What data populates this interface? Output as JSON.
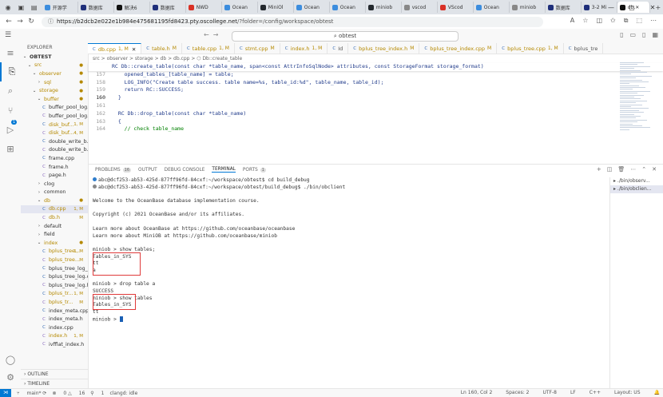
{
  "browser": {
    "tabs": [
      {
        "label": "开源学",
        "color": "#3c8dde"
      },
      {
        "label": "数据库",
        "color": "#1f2f7a"
      },
      {
        "label": "解决6",
        "color": "#111111"
      },
      {
        "label": "数据库",
        "color": "#1f2f7a"
      },
      {
        "label": "NWD",
        "color": "#d93025"
      },
      {
        "label": "Ocean",
        "color": "#3c8dde"
      },
      {
        "label": "MiniOl",
        "color": "#24292e"
      },
      {
        "label": "Ocean",
        "color": "#3c8dde"
      },
      {
        "label": "Ocean",
        "color": "#3c8dde"
      },
      {
        "label": "miniob",
        "color": "#24292e"
      },
      {
        "label": "vscod",
        "color": "#888888"
      },
      {
        "label": "VScod",
        "color": "#d93025"
      },
      {
        "label": "Ocean",
        "color": "#3c8dde"
      },
      {
        "label": "miniob",
        "color": "#888888"
      },
      {
        "label": "数据库",
        "color": "#1f2f7a"
      },
      {
        "label": "3-2 Mi",
        "color": "#1f2f7a"
      },
      {
        "label": "db.",
        "color": "#111111",
        "active": true
      }
    ],
    "new_tab": "+",
    "url_host": "https://b2dcb2e022e1b984e475681195fd8423.pty.oscollege.net",
    "url_path": "/?folder=/config/workspace/obtest"
  },
  "vscode": {
    "search_text": "obtest",
    "explorer_title": "EXPLORER",
    "tree": [
      {
        "label": "OBTEST",
        "indent": 0,
        "icon": "⌄",
        "bold": true
      },
      {
        "label": "src",
        "indent": 1,
        "icon": "⌄",
        "status": "●",
        "scolor": "#b58900",
        "tcolor": "#b58900"
      },
      {
        "label": "observer",
        "indent": 2,
        "icon": "⌄",
        "status": "●",
        "scolor": "#b58900",
        "tcolor": "#b58900"
      },
      {
        "label": "sql",
        "indent": 3,
        "icon": "›",
        "status": "●",
        "scolor": "#b58900",
        "tcolor": "#b58900"
      },
      {
        "label": "storage",
        "indent": 2,
        "icon": "⌄",
        "status": "●",
        "scolor": "#b58900",
        "tcolor": "#b58900"
      },
      {
        "label": "buffer",
        "indent": 3,
        "icon": "⌄",
        "status": "●",
        "scolor": "#b58900",
        "tcolor": "#b58900"
      },
      {
        "label": "buffer_pool_log...",
        "indent": 4,
        "icon": "C",
        "ic": "#3b6fb6"
      },
      {
        "label": "buffer_pool_log.h",
        "indent": 4,
        "icon": "C",
        "ic": "#8a6bbf"
      },
      {
        "label": "disk_buf...",
        "indent": 4,
        "icon": "C",
        "ic": "#3b6fb6",
        "status": "1, M",
        "scolor": "#b58900",
        "tcolor": "#b58900"
      },
      {
        "label": "disk_buf...",
        "indent": 4,
        "icon": "C",
        "ic": "#8a6bbf",
        "status": "4, M",
        "scolor": "#b58900",
        "tcolor": "#b58900"
      },
      {
        "label": "double_write_b...",
        "indent": 4,
        "icon": "C",
        "ic": "#3b6fb6"
      },
      {
        "label": "double_write_b...",
        "indent": 4,
        "icon": "C",
        "ic": "#8a6bbf"
      },
      {
        "label": "frame.cpp",
        "indent": 4,
        "icon": "C",
        "ic": "#3b6fb6"
      },
      {
        "label": "frame.h",
        "indent": 4,
        "icon": "C",
        "ic": "#8a6bbf"
      },
      {
        "label": "page.h",
        "indent": 4,
        "icon": "C",
        "ic": "#8a6bbf"
      },
      {
        "label": "clog",
        "indent": 3,
        "icon": "›"
      },
      {
        "label": "common",
        "indent": 3,
        "icon": "›"
      },
      {
        "label": "db",
        "indent": 3,
        "icon": "⌄",
        "status": "●",
        "scolor": "#b58900",
        "tcolor": "#b58900"
      },
      {
        "label": "db.cpp",
        "indent": 4,
        "icon": "C",
        "ic": "#3b6fb6",
        "status": "1, M",
        "scolor": "#b58900",
        "tcolor": "#b58900",
        "sel": true
      },
      {
        "label": "db.h",
        "indent": 4,
        "icon": "C",
        "ic": "#8a6bbf",
        "status": "M",
        "scolor": "#b58900",
        "tcolor": "#b58900"
      },
      {
        "label": "default",
        "indent": 3,
        "icon": "›"
      },
      {
        "label": "field",
        "indent": 3,
        "icon": "›"
      },
      {
        "label": "index",
        "indent": 3,
        "icon": "⌄",
        "status": "●",
        "scolor": "#b58900",
        "tcolor": "#b58900"
      },
      {
        "label": "bplus_tree...",
        "indent": 4,
        "icon": "C",
        "ic": "#3b6fb6",
        "status": "1, M",
        "scolor": "#b58900",
        "tcolor": "#b58900"
      },
      {
        "label": "bplus_tree...",
        "indent": 4,
        "icon": "C",
        "ic": "#8a6bbf",
        "status": "M",
        "scolor": "#b58900",
        "tcolor": "#b58900"
      },
      {
        "label": "bplus_tree_log_...",
        "indent": 4,
        "icon": "C",
        "ic": "#3b6fb6"
      },
      {
        "label": "bplus_tree_log.c...",
        "indent": 4,
        "icon": "C",
        "ic": "#3b6fb6"
      },
      {
        "label": "bplus_tree_log.h",
        "indent": 4,
        "icon": "C",
        "ic": "#8a6bbf"
      },
      {
        "label": "bplus_tr...",
        "indent": 4,
        "icon": "C",
        "ic": "#3b6fb6",
        "status": "1, M",
        "scolor": "#b58900",
        "tcolor": "#b58900"
      },
      {
        "label": "bplus_tr...",
        "indent": 4,
        "icon": "C",
        "ic": "#8a6bbf",
        "status": "M",
        "scolor": "#b58900",
        "tcolor": "#b58900"
      },
      {
        "label": "index_meta.cpp",
        "indent": 4,
        "icon": "C",
        "ic": "#3b6fb6"
      },
      {
        "label": "index_meta.h",
        "indent": 4,
        "icon": "C",
        "ic": "#8a6bbf"
      },
      {
        "label": "index.cpp",
        "indent": 4,
        "icon": "C",
        "ic": "#3b6fb6"
      },
      {
        "label": "index.h",
        "indent": 4,
        "icon": "C",
        "ic": "#8a6bbf",
        "status": "1, M",
        "scolor": "#b58900",
        "tcolor": "#b58900"
      },
      {
        "label": "ivfflat_index.h",
        "indent": 4,
        "icon": "C",
        "ic": "#8a6bbf"
      }
    ],
    "outline_label": "OUTLINE",
    "timeline_label": "TIMELINE",
    "scm_badge": "1",
    "editor_tabs": [
      {
        "label": "db.cpp",
        "mod": "1, M",
        "active": true
      },
      {
        "label": "table.h",
        "mod": "M"
      },
      {
        "label": "table.cpp",
        "mod": "1, M"
      },
      {
        "label": "stmt.cpp",
        "mod": "M"
      },
      {
        "label": "index.h",
        "mod": "1, M"
      },
      {
        "label": "Id",
        "mod": ""
      },
      {
        "label": "bplus_tree_index.h",
        "mod": "M"
      },
      {
        "label": "bplus_tree_index.cpp",
        "mod": "M"
      },
      {
        "label": "bplus_tree.cpp",
        "mod": "1, M"
      },
      {
        "label": "bplus_tre",
        "mod": ""
      }
    ],
    "breadcrumb": "src > observer > storage > db > db.cpp > ⬡ Db::create_table",
    "code_lines": [
      {
        "n": "",
        "t": "RC Db::create_table(const char *table_name, span<const AttrInfoSqlNode> attributes, const StorageFormat storage_format)",
        "sticky": true
      },
      {
        "n": "157",
        "t": "    opened_tables_[table_name] = table;"
      },
      {
        "n": "158",
        "t": "    LOG_INFO(\"Create table success. table name=%s, table_id:%d\", table_name, table_id);"
      },
      {
        "n": "159",
        "t": "    return RC::SUCCESS;"
      },
      {
        "n": "160",
        "t": "  }",
        "cur": true
      },
      {
        "n": "161",
        "t": ""
      },
      {
        "n": "162",
        "t": "  RC Db::drop_table(const char *table_name)"
      },
      {
        "n": "163",
        "t": "  {"
      },
      {
        "n": "164",
        "t": "    // check table_name",
        "cmt": true
      }
    ],
    "panel_tabs": [
      {
        "label": "PROBLEMS",
        "badge": "16"
      },
      {
        "label": "OUTPUT",
        "badge": ""
      },
      {
        "label": "DEBUG CONSOLE",
        "badge": ""
      },
      {
        "label": "TERMINAL",
        "badge": "",
        "active": true
      },
      {
        "label": "PORTS",
        "badge": "1"
      }
    ],
    "terminal_lines": [
      {
        "t": "abc@dcf253-ab53-425d-877ff96fd-84cxf:~/workspace/obtest$ cd build_debug",
        "dot": "#2e7dcc"
      },
      {
        "t": "abc@dcf253-ab53-425d-877ff96fd-84cxf:~/workspace/obtest/build_debug$ ./bin/obclient",
        "dot": "#888888"
      },
      {
        "t": ""
      },
      {
        "t": "Welcome to the OceanBase database implementation course."
      },
      {
        "t": ""
      },
      {
        "t": "Copyright (c) 2021 OceanBase and/or its affiliates."
      },
      {
        "t": ""
      },
      {
        "t": "Learn more about OceanBase at https://github.com/oceanbase/oceanbase"
      },
      {
        "t": "Learn more about MiniOB at https://github.com/oceanbase/miniob"
      },
      {
        "t": ""
      },
      {
        "t": "miniob > show tables;"
      },
      {
        "t": "Tables_in_SYS"
      },
      {
        "t": "tt"
      },
      {
        "t": "a"
      },
      {
        "t": ""
      },
      {
        "t": "miniob > drop table a"
      },
      {
        "t": "SUCCESS"
      },
      {
        "t": "miniob > show tables"
      },
      {
        "t": "Tables_in_SYS"
      },
      {
        "t": "tt"
      },
      {
        "t": "miniob > ",
        "cursor": true
      }
    ],
    "terminal_list": [
      {
        "label": "./bin/observ..."
      },
      {
        "label": "./bin/obclien...",
        "sel": true
      }
    ],
    "status": {
      "branch": "main*",
      "errors": "0",
      "warnings": "16",
      "ports": "1",
      "clangd": "clangd: idle",
      "position": "Ln 160, Col 2",
      "spaces": "Spaces: 2",
      "encoding": "UTF-8",
      "eol": "LF",
      "language": "C++",
      "layout": "Layout: US"
    }
  }
}
